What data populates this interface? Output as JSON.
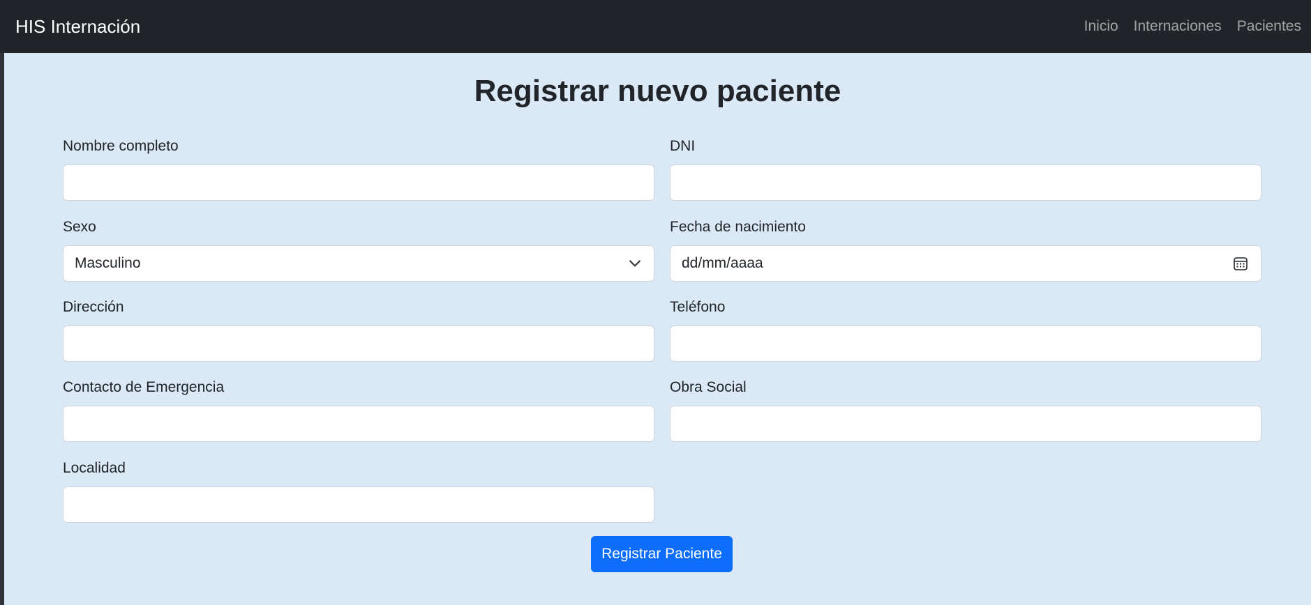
{
  "navbar": {
    "brand": "HIS Internación",
    "links": [
      "Inicio",
      "Internaciones",
      "Pacientes"
    ]
  },
  "form": {
    "title": "Registrar nuevo paciente",
    "fields": {
      "nombre": {
        "label": "Nombre completo",
        "value": ""
      },
      "dni": {
        "label": "DNI",
        "value": ""
      },
      "sexo": {
        "label": "Sexo",
        "value": "Masculino"
      },
      "fecha_nacimiento": {
        "label": "Fecha de nacimiento",
        "placeholder": "dd/mm/aaaa"
      },
      "direccion": {
        "label": "Dirección",
        "value": ""
      },
      "telefono": {
        "label": "Teléfono",
        "value": ""
      },
      "contacto_emergencia": {
        "label": "Contacto de Emergencia",
        "value": ""
      },
      "obra_social": {
        "label": "Obra Social",
        "value": ""
      },
      "localidad": {
        "label": "Localidad",
        "value": ""
      }
    },
    "submit_label": "Registrar Paciente"
  },
  "colors": {
    "navbar_bg": "#212529",
    "page_bg": "#dbe9f7",
    "primary": "#0d6efd"
  },
  "icons": {
    "select": "chevron-down-icon",
    "date": "calendar-icon"
  }
}
